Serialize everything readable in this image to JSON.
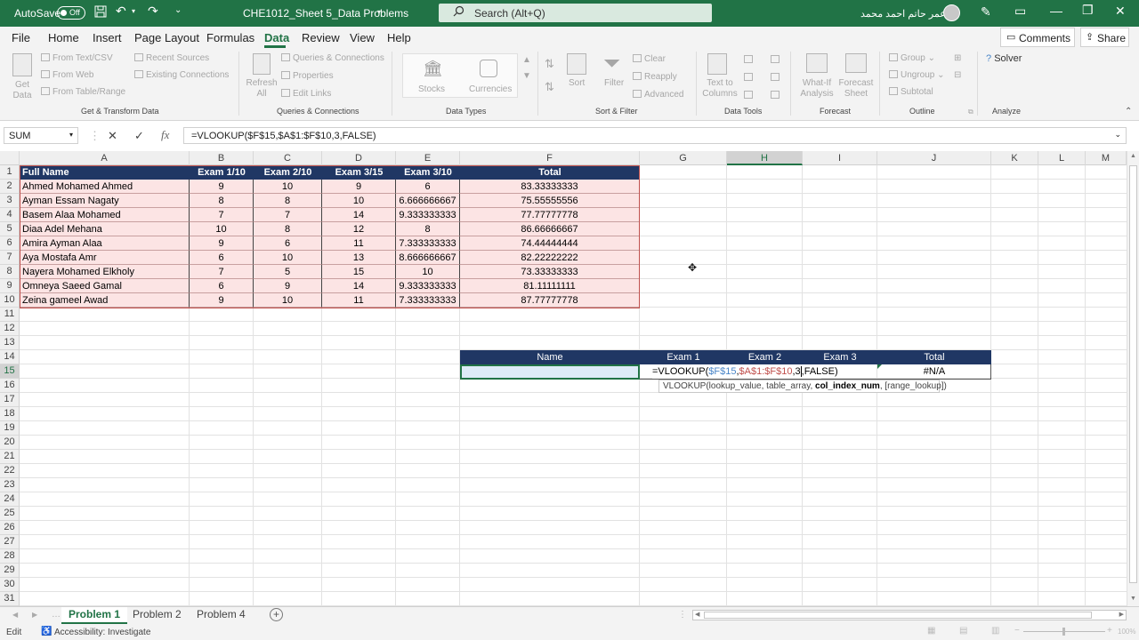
{
  "titlebar": {
    "autosave": "AutoSave",
    "toggle": "Off",
    "filename": "CHE1012_Sheet 5_Data Problems",
    "search": "Search (Alt+Q)",
    "username": "عمر حاتم احمد محمد"
  },
  "menu": {
    "items": [
      "File",
      "Home",
      "Insert",
      "Page Layout",
      "Formulas",
      "Data",
      "Review",
      "View",
      "Help"
    ],
    "active": "Data",
    "comments": "Comments",
    "share": "Share"
  },
  "ribbon": {
    "get_data": "Get Data",
    "from_text_csv": "From Text/CSV",
    "from_web": "From Web",
    "from_table_range": "From Table/Range",
    "recent_sources": "Recent Sources",
    "existing_connections": "Existing Connections",
    "refresh_all": "Refresh All",
    "queries_connections": "Queries & Connections",
    "properties": "Properties",
    "edit_links": "Edit Links",
    "stocks": "Stocks",
    "currencies": "Currencies",
    "sort": "Sort",
    "filter": "Filter",
    "clear": "Clear",
    "reapply": "Reapply",
    "advanced": "Advanced",
    "text_to_columns": "Text to Columns",
    "what_if": "What-If Analysis",
    "forecast_sheet": "Forecast Sheet",
    "group": "Group",
    "ungroup": "Ungroup",
    "subtotal": "Subtotal",
    "solver": "Solver",
    "groups": [
      "Get & Transform Data",
      "Queries & Connections",
      "Data Types",
      "Sort & Filter",
      "Data Tools",
      "Forecast",
      "Outline",
      "Analyze"
    ]
  },
  "formula_bar": {
    "name_box": "SUM",
    "formula": "=VLOOKUP($F$15,$A$1:$F$10,3,FALSE)"
  },
  "columns": [
    "A",
    "B",
    "C",
    "D",
    "E",
    "F",
    "G",
    "H",
    "I",
    "J",
    "K",
    "L",
    "M"
  ],
  "rows": [
    "1",
    "2",
    "3",
    "4",
    "5",
    "6",
    "7",
    "8",
    "9",
    "10",
    "11",
    "12",
    "13",
    "14",
    "15",
    "16",
    "17",
    "18",
    "19",
    "20",
    "21",
    "22",
    "23",
    "24",
    "25",
    "26",
    "27",
    "28",
    "29",
    "30",
    "31"
  ],
  "table": {
    "headers": [
      "Full Name",
      "Exam 1/10",
      "Exam 2/10",
      "Exam 3/15",
      "Exam 3/10",
      "Total"
    ],
    "rows": [
      [
        "Ahmed Mohamed Ahmed",
        "9",
        "10",
        "9",
        "6",
        "83.33333333"
      ],
      [
        "Ayman Essam Nagaty",
        "8",
        "8",
        "10",
        "6.666666667",
        "75.55555556"
      ],
      [
        "Basem Alaa Mohamed",
        "7",
        "7",
        "14",
        "9.333333333",
        "77.77777778"
      ],
      [
        "Diaa Adel Mehana",
        "10",
        "8",
        "12",
        "8",
        "86.66666667"
      ],
      [
        "Amira Ayman Alaa",
        "9",
        "6",
        "11",
        "7.333333333",
        "74.44444444"
      ],
      [
        "Aya Mostafa Amr",
        "6",
        "10",
        "13",
        "8.666666667",
        "82.22222222"
      ],
      [
        "Nayera Mohamed Elkholy",
        "7",
        "5",
        "15",
        "10",
        "73.33333333"
      ],
      [
        "Omneya Saeed Gamal",
        "6",
        "9",
        "14",
        "9.333333333",
        "81.11111111"
      ],
      [
        "Zeina gameel Awad",
        "9",
        "10",
        "11",
        "7.333333333",
        "87.77777778"
      ]
    ]
  },
  "lookup": {
    "headers": [
      "Name",
      "Exam 1",
      "Exam 2",
      "Exam 3",
      "Total"
    ],
    "edit": {
      "prefix": "=VLOOKUP(",
      "arg1": "$F$15",
      "c1": ",",
      "arg2": "$A$1:$F$10",
      "c2": ",",
      "arg3": "3",
      "suffix": ",FALSE)"
    },
    "total": "#N/A"
  },
  "tooltip": {
    "pre": "VLOOKUP(lookup_value, table_array, ",
    "bold": "col_index_num",
    "post": ", [range_lookup])"
  },
  "sheets": {
    "tabs": [
      "Problem 1",
      "Problem 2",
      "Problem 4"
    ],
    "active": "Problem 1"
  },
  "status": {
    "mode": "Edit",
    "accessibility": "Accessibility: Investigate",
    "zoom": "100%"
  },
  "colors": {
    "excel_green": "#217346",
    "header_navy": "#203764",
    "data_pink": "#fce4e4",
    "ref_blue": "#4a86c8",
    "ref_red": "#c0504d"
  }
}
